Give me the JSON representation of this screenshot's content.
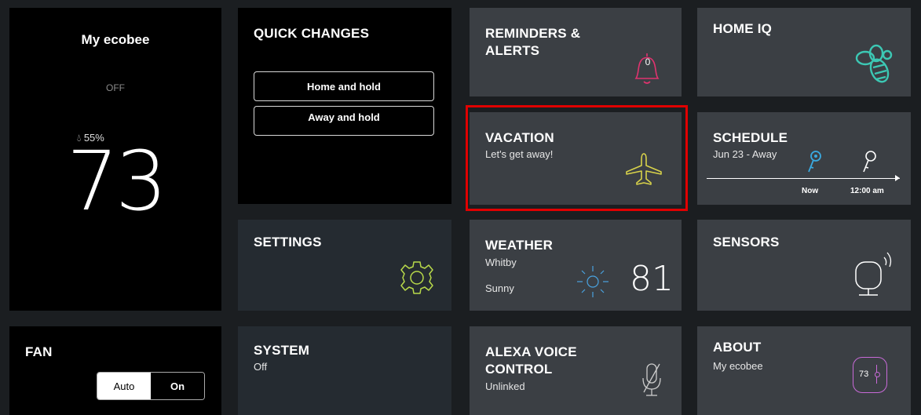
{
  "thermostat": {
    "name": "My ecobee",
    "mode": "OFF",
    "humidity": "55%",
    "temperature": "73"
  },
  "quick_changes": {
    "title": "QUICK CHANGES",
    "buttons": [
      "Home and hold",
      "Away and hold"
    ]
  },
  "reminders": {
    "title": "REMINDERS & ALERTS",
    "count": "0"
  },
  "home_iq": {
    "title": "HOME IQ"
  },
  "vacation": {
    "title": "VACATION",
    "subtitle": "Let's get away!"
  },
  "schedule": {
    "title": "SCHEDULE",
    "subtitle": "Jun 23 - Away",
    "now_label": "Now",
    "next_time": "12:00 am"
  },
  "settings": {
    "title": "SETTINGS"
  },
  "weather": {
    "title": "WEATHER",
    "city": "Whitby",
    "condition": "Sunny",
    "temperature": "81"
  },
  "sensors": {
    "title": "SENSORS"
  },
  "fan": {
    "title": "FAN",
    "options": [
      "Auto",
      "On"
    ],
    "selected": "Auto"
  },
  "system": {
    "title": "SYSTEM",
    "status": "Off"
  },
  "alexa": {
    "title": "ALEXA VOICE CONTROL",
    "status": "Unlinked"
  },
  "about": {
    "title": "ABOUT",
    "subtitle": "My ecobee",
    "temperature": "73"
  },
  "colors": {
    "alert_pink": "#e0336f",
    "homeiq_teal": "#3cc8b4",
    "vacation_yellow": "#d8d24a",
    "schedule_blue": "#3aa9e0",
    "settings_green": "#b8d94a",
    "weather_blue": "#4aa3e0",
    "about_purple": "#c86ad8",
    "highlight_red": "#e00000"
  }
}
